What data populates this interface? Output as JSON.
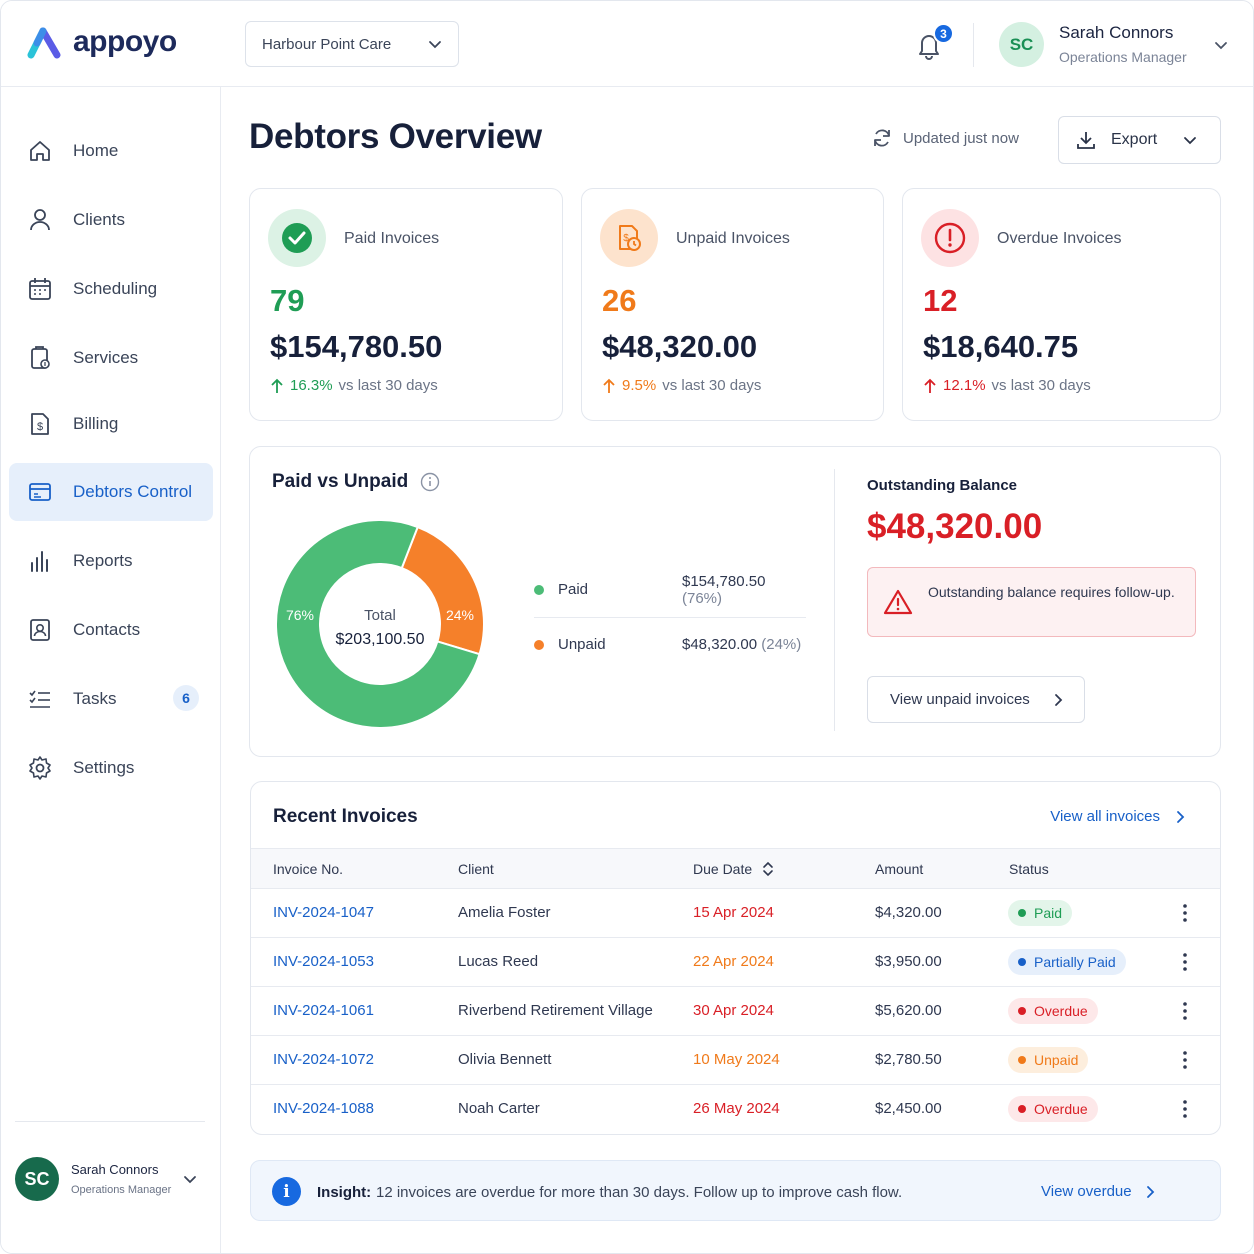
{
  "brand": {
    "name": "appoyo"
  },
  "header": {
    "org_selector": "Harbour Point Care",
    "notifications_count": "3",
    "user": {
      "initials": "SC",
      "name": "Sarah Connors",
      "role": "Operations Manager"
    }
  },
  "sidebar": {
    "items": [
      {
        "label": "Home",
        "icon": "home-icon"
      },
      {
        "label": "Clients",
        "icon": "user-icon"
      },
      {
        "label": "Scheduling",
        "icon": "calendar-icon"
      },
      {
        "label": "Services",
        "icon": "clipboard-icon"
      },
      {
        "label": "Billing",
        "icon": "invoice-icon"
      },
      {
        "label": "Debtors Control",
        "icon": "card-icon",
        "active": true
      },
      {
        "label": "Reports",
        "icon": "bar-chart-icon"
      },
      {
        "label": "Contacts",
        "icon": "contact-icon"
      },
      {
        "label": "Tasks",
        "icon": "tasks-icon",
        "badge": "6"
      },
      {
        "label": "Settings",
        "icon": "gear-icon"
      }
    ],
    "user": {
      "initials": "SC",
      "name": "Sarah Connors",
      "role": "Operations Manager"
    }
  },
  "page": {
    "title": "Debtors Overview",
    "updated": "Updated just now",
    "export_label": "Export"
  },
  "kpis": [
    {
      "label": "Paid Invoices",
      "count": "79",
      "amount": "$154,780.50",
      "change": "16.3%",
      "suffix": "vs last 30 days",
      "color": "#1f9d55"
    },
    {
      "label": "Unpaid Invoices",
      "count": "26",
      "amount": "$48,320.00",
      "change": "9.5%",
      "suffix": "vs last 30 days",
      "color": "#f07a1a"
    },
    {
      "label": "Overdue Invoices",
      "count": "12",
      "amount": "$18,640.75",
      "change": "12.1%",
      "suffix": "vs last 30 days",
      "color": "#d91f26"
    }
  ],
  "paid_vs_unpaid": {
    "title": "Paid vs Unpaid",
    "total_label": "Total",
    "total_value": "$203,100.50",
    "paid_pct_label": "76%",
    "unpaid_pct_label": "24%",
    "legend": [
      {
        "name": "Paid",
        "value": "$154,780.50",
        "pct": "(76%)",
        "color": "#4cbc77"
      },
      {
        "name": "Unpaid",
        "value": "$48,320.00",
        "pct": "(24%)",
        "color": "#f5802a"
      }
    ]
  },
  "chart_data": {
    "type": "pie",
    "categories": [
      "Paid",
      "Unpaid"
    ],
    "values": [
      154780.5,
      48320.0
    ],
    "percentages": [
      76,
      24
    ],
    "colors": [
      "#4cbc77",
      "#f5802a"
    ],
    "title": "Paid vs Unpaid",
    "center_label": "Total",
    "center_value": "$203,100.50"
  },
  "outstanding": {
    "title": "Outstanding Balance",
    "amount": "$48,320.00",
    "alert_text": "Outstanding balance requires follow-up.",
    "button": "View unpaid invoices"
  },
  "recent_invoices": {
    "title": "Recent Invoices",
    "view_all": "View all invoices",
    "columns": [
      "Invoice No.",
      "Client",
      "Due Date",
      "Amount",
      "Status"
    ],
    "rows": [
      {
        "invoice": "INV-2024-1047",
        "client": "Amelia Foster",
        "due": "15 Apr 2024",
        "due_color": "#d91f26",
        "amount": "$4,320.00",
        "status": "Paid",
        "status_color": "#1f9d55",
        "status_bg": "#e3f5ea"
      },
      {
        "invoice": "INV-2024-1053",
        "client": "Lucas Reed",
        "due": "22 Apr 2024",
        "due_color": "#f07a1a",
        "amount": "$3,950.00",
        "status": "Partially Paid",
        "status_color": "#1860c8",
        "status_bg": "#e6effb"
      },
      {
        "invoice": "INV-2024-1061",
        "client": "Riverbend Retirement Village",
        "due": "30 Apr 2024",
        "due_color": "#d91f26",
        "amount": "$5,620.00",
        "status": "Overdue",
        "status_color": "#d91f26",
        "status_bg": "#fde8e9"
      },
      {
        "invoice": "INV-2024-1072",
        "client": "Olivia Bennett",
        "due": "10 May 2024",
        "due_color": "#f07a1a",
        "amount": "$2,780.50",
        "status": "Unpaid",
        "status_color": "#f07a1a",
        "status_bg": "#fdeedd"
      },
      {
        "invoice": "INV-2024-1088",
        "client": "Noah Carter",
        "due": "26 May 2024",
        "due_color": "#d91f26",
        "amount": "$2,450.00",
        "status": "Overdue",
        "status_color": "#d91f26",
        "status_bg": "#fde8e9"
      }
    ]
  },
  "insight": {
    "label": "Insight:",
    "text": "12 invoices are overdue for more than 30 days. Follow up to improve cash flow.",
    "link": "View overdue"
  }
}
